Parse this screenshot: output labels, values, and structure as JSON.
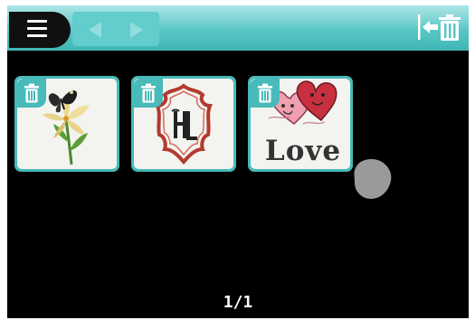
{
  "toolbar": {
    "menu_icon": "hamburger-menu-icon",
    "prev_icon": "arrow-left-icon",
    "next_icon": "arrow-right-icon",
    "exit_icon": "exit-delete-icon",
    "bar_color": "#59c6c6"
  },
  "thumbnails": [
    {
      "design": "butterfly-lily-embroidery",
      "delete_icon": "trash-icon"
    },
    {
      "design": "monogram-hl-frame-embroidery",
      "delete_icon": "trash-icon"
    },
    {
      "design": "love-heart-embroidery",
      "text": "Love",
      "delete_icon": "trash-icon"
    }
  ],
  "pagination": {
    "label": "1/1"
  }
}
